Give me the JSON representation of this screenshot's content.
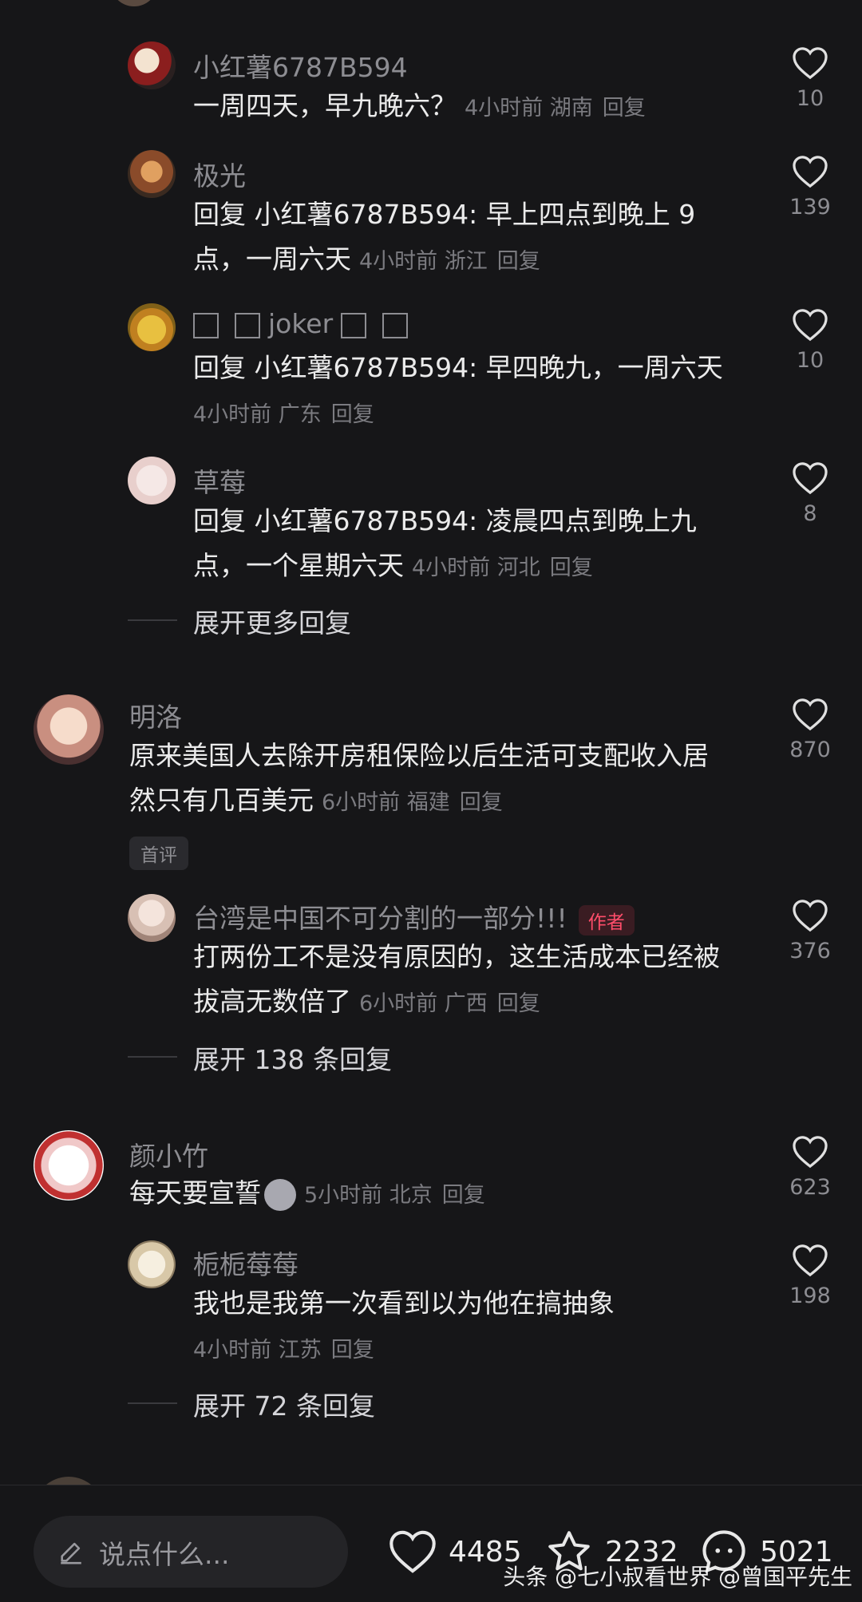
{
  "comments": {
    "r1": {
      "name": "小红薯6787B594",
      "text": "一周四天，早九晚六？",
      "time": "4小时前",
      "region": "湖南",
      "reply_label": "回复",
      "likes": "10"
    },
    "r2": {
      "name": "极光",
      "line1": "回复 小红薯6787B594: 早上四点到晚上 9",
      "line2": "点，一周六天",
      "time": "4小时前",
      "region": "浙江",
      "reply_label": "回复",
      "likes": "139"
    },
    "r3": {
      "name_text": "joker",
      "line1": "回复 小红薯6787B594: 早四晚九，一周六天",
      "time": "4小时前",
      "region": "广东",
      "reply_label": "回复",
      "likes": "10"
    },
    "r4": {
      "name": "草莓",
      "line1": "回复 小红薯6787B594: 凌晨四点到晚上九",
      "line2": "点，一个星期六天",
      "time": "4小时前",
      "region": "河北",
      "reply_label": "回复",
      "likes": "8"
    },
    "expand1": "展开更多回复",
    "c1": {
      "name": "明洛",
      "line1": "原来美国人去除开房租保险以后生活可支配收入居",
      "line2": "然只有几百美元",
      "time": "6小时前",
      "region": "福建",
      "reply_label": "回复",
      "likes": "870",
      "badge": "首评"
    },
    "r5": {
      "name": "台湾是中国不可分割的一部分!!!",
      "author_badge": "作者",
      "line1": "打两份工不是没有原因的，这生活成本已经被",
      "line2": "拔高无数倍了",
      "time": "6小时前",
      "region": "广西",
      "reply_label": "回复",
      "likes": "376"
    },
    "expand2": "展开 138 条回复",
    "c2": {
      "name": "颜小竹",
      "line1": "每天要宣誓",
      "time": "5小时前",
      "region": "北京",
      "reply_label": "回复",
      "likes": "623"
    },
    "r6": {
      "name": "栀栀莓莓",
      "line1": "我也是我第一次看到以为他在搞抽象",
      "time": "4小时前",
      "region": "江苏",
      "reply_label": "回复",
      "likes": "198"
    },
    "expand3": "展开 72 条回复"
  },
  "bottom_bar": {
    "placeholder": "说点什么...",
    "likes": "4485",
    "favorites": "2232",
    "comments": "5021"
  },
  "watermark": "头条 @七小叔看世界 @曾国平先生",
  "colors": {
    "background": "#161618",
    "author_badge": "#ff4d6a"
  }
}
